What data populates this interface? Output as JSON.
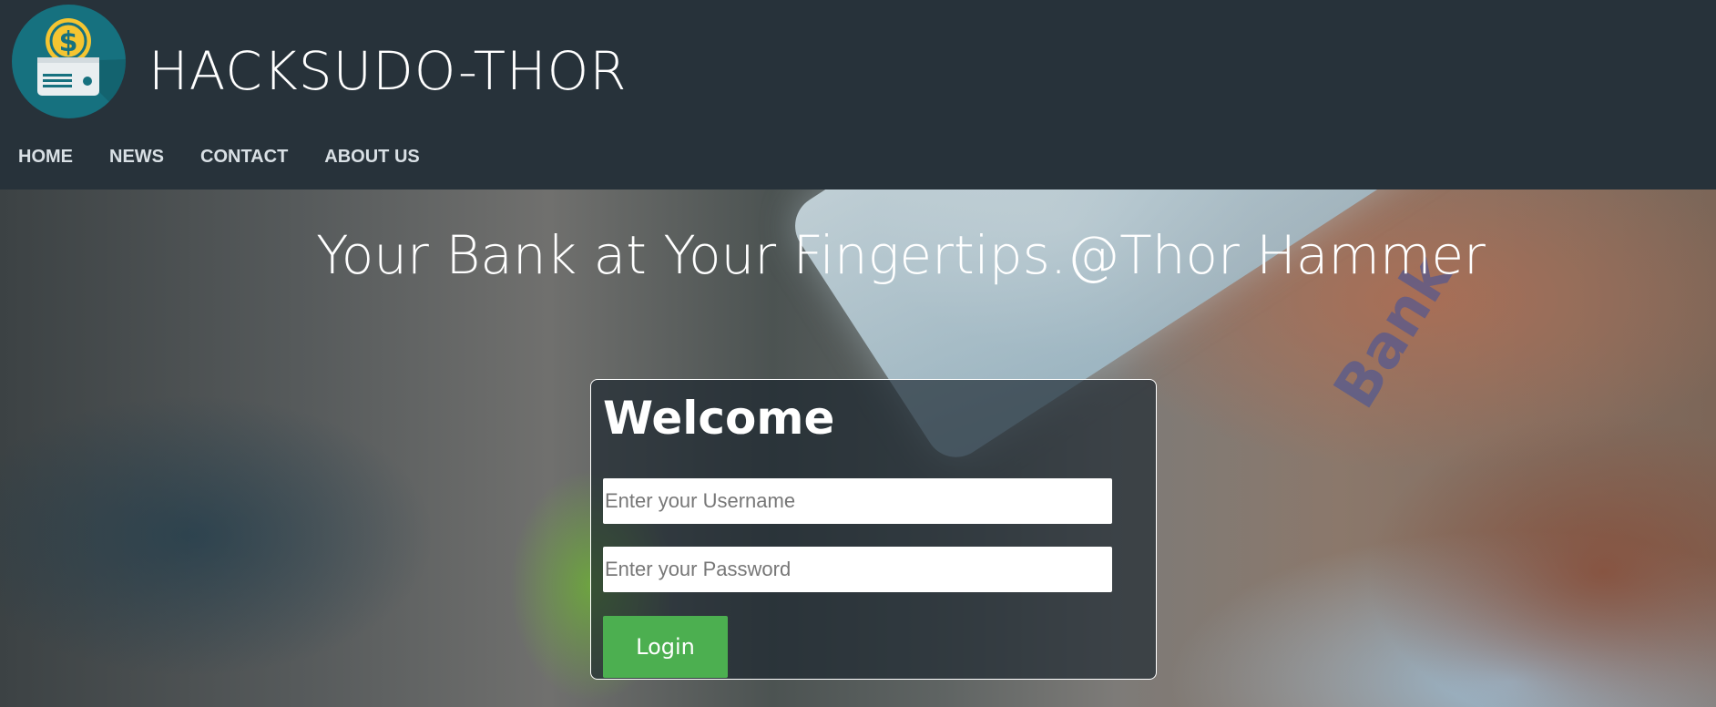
{
  "site": {
    "title": "HACKSUDO-THOR",
    "logo_icon": "bank-card-dollar-icon"
  },
  "nav": {
    "items": [
      {
        "label": "HOME"
      },
      {
        "label": "NEWS"
      },
      {
        "label": "CONTACT"
      },
      {
        "label": "ABOUT US"
      }
    ]
  },
  "hero": {
    "headline": "Your Bank at Your Fingertips.@Thor Hammer",
    "card_text": "Bank"
  },
  "login": {
    "heading": "Welcome",
    "username_placeholder": "Enter your Username",
    "password_placeholder": "Enter your Password",
    "button_label": "Login"
  },
  "colors": {
    "header_bg": "#27323a",
    "logo_bg": "#16717f",
    "button_bg": "#4caf50"
  }
}
